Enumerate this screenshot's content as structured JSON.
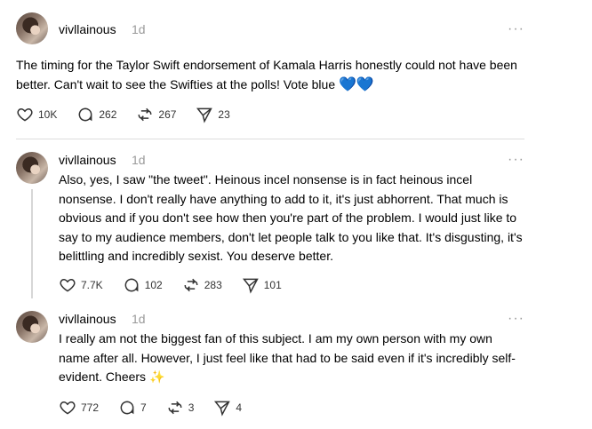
{
  "posts": [
    {
      "username": "vivllainous",
      "time": "1d",
      "text": "The timing for the Taylor Swift endorsement of Kamala Harris honestly could not have been better. Can't wait to see the Swifties at the polls! Vote blue",
      "emoji": "💙💙",
      "likes": "10K",
      "replies": "262",
      "reposts": "267",
      "shares": "23"
    },
    {
      "username": "vivllainous",
      "time": "1d",
      "text": "Also, yes, I saw \"the tweet\". Heinous incel nonsense is in fact heinous incel nonsense. I don't really have anything to add to it, it's just abhorrent. That much is obvious and if you don't see how then you're part of the problem. I would just like to say to my audience members, don't let people talk to you like that. It's disgusting, it's belittling and incredibly sexist. You deserve better.",
      "likes": "7.7K",
      "replies": "102",
      "reposts": "283",
      "shares": "101"
    },
    {
      "username": "vivllainous",
      "time": "1d",
      "text": "I really am not the biggest fan of this subject. I am my own person with my own name after all. However, I just feel like that had to be said even if it's incredibly self-evident. Cheers",
      "emoji": "✨",
      "likes": "772",
      "replies": "7",
      "reposts": "3",
      "shares": "4"
    }
  ],
  "more_label": "···"
}
